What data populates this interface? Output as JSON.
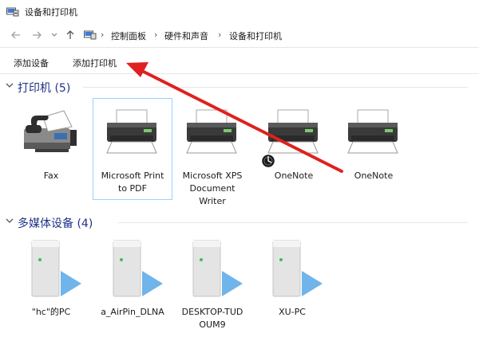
{
  "window": {
    "title": "设备和打印机"
  },
  "address": {
    "breadcrumbs": [
      "控制面板",
      "硬件和声音",
      "设备和打印机"
    ]
  },
  "toolbar": {
    "add_device_label": "添加设备",
    "add_printer_label": "添加打印机"
  },
  "groups": {
    "printers": {
      "label": "打印机 (5)",
      "items": [
        {
          "name": "Fax",
          "icon": "fax-icon"
        },
        {
          "name_lines": [
            "Microsoft Print",
            "to PDF"
          ],
          "icon": "printer-icon"
        },
        {
          "name_lines": [
            "Microsoft XPS",
            "Document",
            "Writer"
          ],
          "icon": "printer-icon"
        },
        {
          "name": "OneNote",
          "icon": "printer-icon"
        },
        {
          "name": "OneNote",
          "icon": "printer-icon"
        }
      ]
    },
    "media": {
      "label": "多媒体设备 (4)",
      "items": [
        {
          "name": "\"hc\"的PC",
          "icon": "media-server-icon"
        },
        {
          "name": "a_AirPin_DLNA",
          "icon": "media-server-icon"
        },
        {
          "name_lines": [
            "DESKTOP-TUD",
            "OUM9"
          ],
          "icon": "media-server-icon"
        },
        {
          "name": "XU-PC",
          "icon": "media-server-icon"
        }
      ]
    }
  },
  "colors": {
    "group_label": "#1e3287",
    "selection_border": "#99d1ff",
    "annotation_arrow": "#e02020"
  }
}
